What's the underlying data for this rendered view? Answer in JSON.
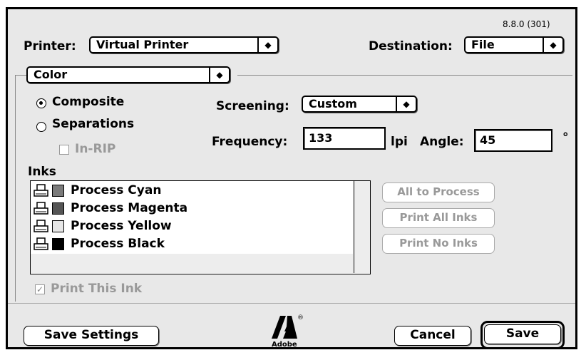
{
  "version": "8.8.0 (301)",
  "printer": {
    "label": "Printer:",
    "value": "Virtual Printer"
  },
  "destination": {
    "label": "Destination:",
    "value": "File"
  },
  "panel_menu": {
    "value": "Color"
  },
  "mode": {
    "composite": "Composite",
    "separations": "Separations",
    "in_rip": "In-RIP",
    "selected": "Composite"
  },
  "screening": {
    "label": "Screening:",
    "value": "Custom"
  },
  "frequency": {
    "label": "Frequency:",
    "value": "133",
    "unit": "lpi"
  },
  "angle": {
    "label": "Angle:",
    "value": "45",
    "unit": "°"
  },
  "inks": {
    "label": "Inks",
    "items": [
      {
        "name": "Process Cyan",
        "color": "#7a7a7a"
      },
      {
        "name": "Process Magenta",
        "color": "#555555"
      },
      {
        "name": "Process Yellow",
        "color": "#e6e6e6"
      },
      {
        "name": "Process Black",
        "color": "#000000"
      }
    ]
  },
  "ink_buttons": {
    "all_to_process": "All to Process",
    "print_all": "Print All Inks",
    "print_none": "Print No Inks"
  },
  "print_this_ink": {
    "label": "Print This Ink",
    "checked": true
  },
  "footer": {
    "save_settings": "Save Settings",
    "cancel": "Cancel",
    "save": "Save",
    "logo_text": "Adobe"
  }
}
